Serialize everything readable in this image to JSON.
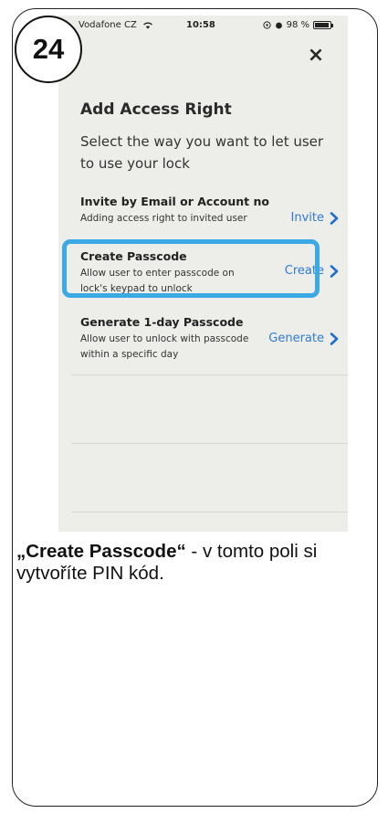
{
  "step_number": "24",
  "status_bar": {
    "carrier": "Vodafone CZ",
    "time": "10:58",
    "battery": "98 %"
  },
  "dialog": {
    "close_icon": "×",
    "title": "Add Access Right",
    "subtitle": "Select the way you want to let user to use your lock",
    "options": [
      {
        "title": "Invite by Email or Account no",
        "description": "Adding access right to invited user",
        "action": "Invite"
      },
      {
        "title": "Create Passcode",
        "description": "Allow user to enter passcode on lock's keypad to unlock",
        "action": "Create"
      },
      {
        "title": "Generate 1-day Passcode",
        "description": "Allow user to unlock with passcode within a specific day",
        "action": "Generate"
      }
    ]
  },
  "highlight_color": "#3aa9e4",
  "accent_color": "#2e7bd8",
  "caption": {
    "bold": "„Create Passcode“",
    "text": "  - v tomto poli si vytvoříte PIN kód."
  }
}
